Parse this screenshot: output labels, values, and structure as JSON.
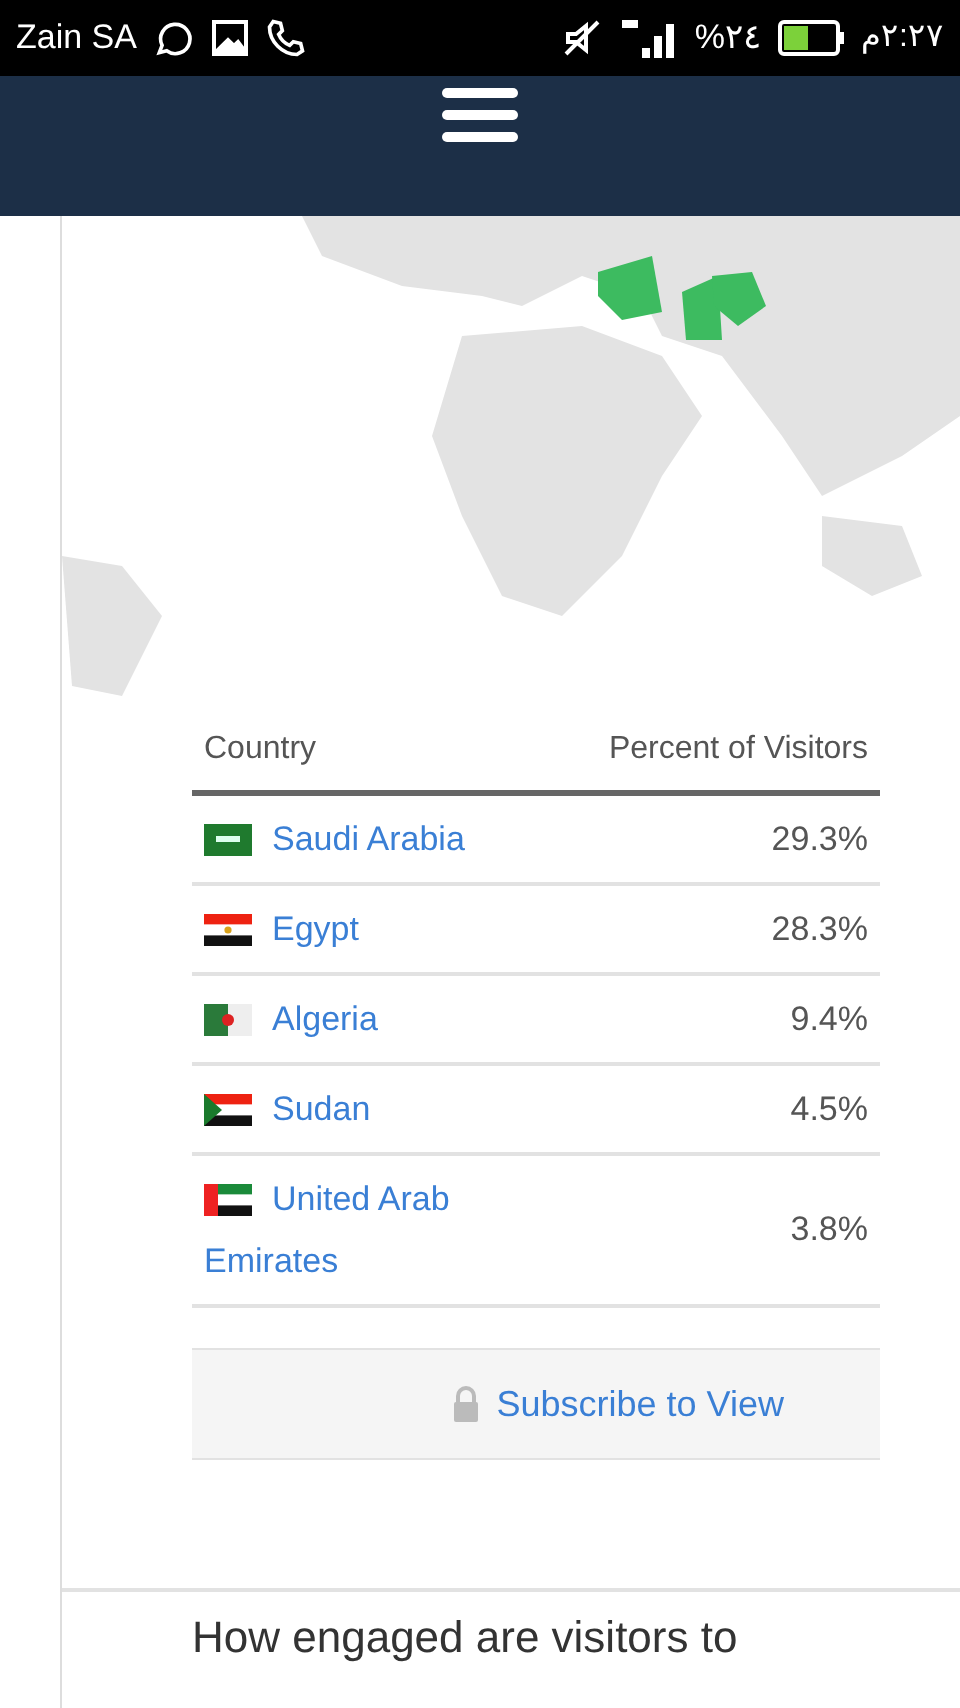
{
  "status_bar": {
    "carrier": "Zain SA",
    "battery": "%٢٤",
    "time": "٢:٢٧م"
  },
  "table": {
    "columns": [
      "Country",
      "Percent of Visitors"
    ],
    "rows": [
      {
        "country": "Saudi Arabia",
        "percent": "29.3%"
      },
      {
        "country": "Egypt",
        "percent": "28.3%"
      },
      {
        "country": "Algeria",
        "percent": "9.4%"
      },
      {
        "country": "Sudan",
        "percent": "4.5%"
      },
      {
        "country": "United Arab Emirates",
        "percent": "3.8%"
      }
    ]
  },
  "subscribe": {
    "label": "Subscribe to View"
  },
  "next_heading": "How engaged are visitors to"
}
